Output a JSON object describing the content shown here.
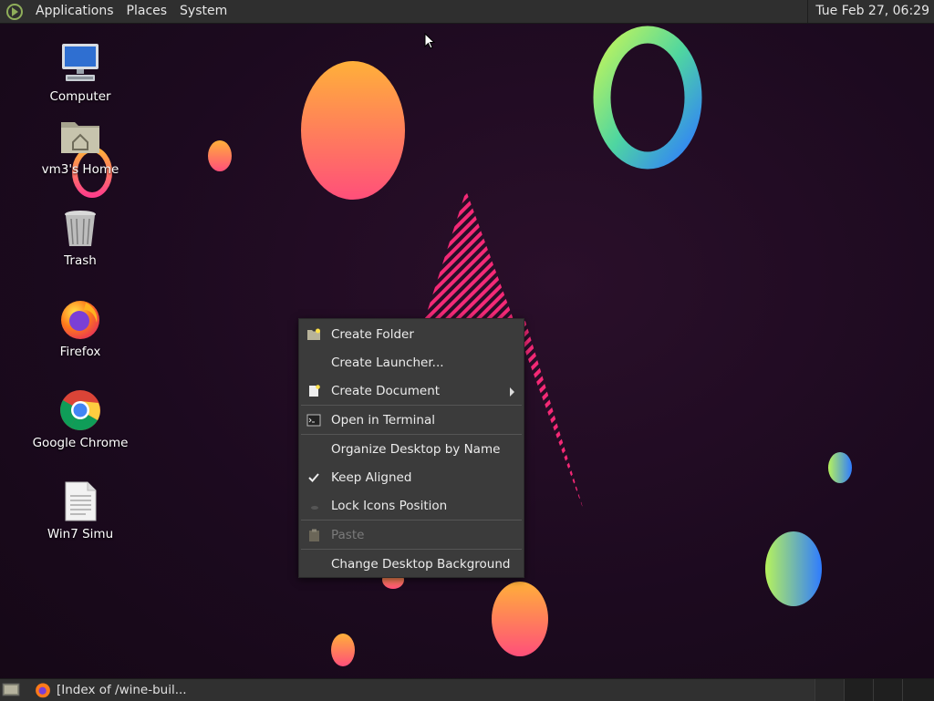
{
  "top_panel": {
    "menus": [
      "Applications",
      "Places",
      "System"
    ],
    "clock": "Tue Feb 27, 06:29"
  },
  "desktop_icons": [
    {
      "label": "Computer",
      "icon": "computer-icon"
    },
    {
      "label": "vm3's Home",
      "icon": "home-folder-icon"
    },
    {
      "label": "Trash",
      "icon": "trash-icon"
    },
    {
      "label": "Firefox",
      "icon": "firefox-icon"
    },
    {
      "label": "Google Chrome",
      "icon": "chrome-icon"
    },
    {
      "label": "Win7 Simu",
      "icon": "document-icon"
    }
  ],
  "context_menu": {
    "items": [
      {
        "label": "Create Folder",
        "icon": "folder-new-icon"
      },
      {
        "label": "Create Launcher...",
        "icon": ""
      },
      {
        "label": "Create Document",
        "icon": "document-new-icon",
        "submenu": true
      },
      {
        "label": "Open in Terminal",
        "icon": "terminal-icon"
      },
      {
        "label": "Organize Desktop by Name",
        "icon": ""
      },
      {
        "label": "Keep Aligned",
        "icon": "check-icon",
        "checked": true
      },
      {
        "label": "Lock Icons Position",
        "icon": "lock-icon"
      },
      {
        "label": "Paste",
        "icon": "paste-icon",
        "disabled": true
      },
      {
        "label": "Change Desktop Background",
        "icon": ""
      }
    ]
  },
  "bottom_panel": {
    "task_label": "[Index of /wine-buil..."
  },
  "colors": {
    "panel": "#2f2f2f",
    "menu_bg": "#3b3b3b",
    "desktop_bg": "#1c0a1f"
  }
}
